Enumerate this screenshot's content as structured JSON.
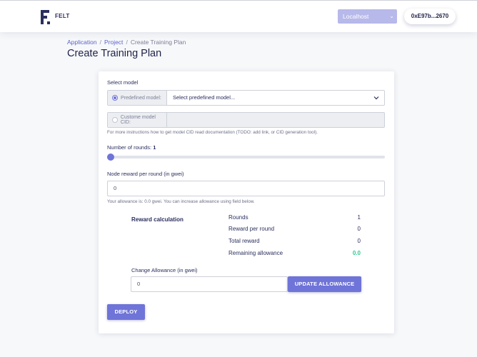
{
  "header": {
    "logo_text": "FELT",
    "network": "Localhost",
    "account": "0xE97b...2670"
  },
  "breadcrumb": [
    "Application",
    "Project",
    "Create Training Plan"
  ],
  "page_title": "Create Training Plan",
  "form": {
    "select_model_label": "Select model",
    "predefined_label": "Predefined model:",
    "predefined_placeholder": "Select predefined model...",
    "custom_label": "Custome model CID:",
    "custom_value": "",
    "model_help": "For more instructions how to get model CID read documentation (TODO: add link, or CID generation tool).",
    "rounds_label": "Number of rounds: ",
    "rounds_value": "1",
    "rounds_fraction": 0,
    "reward_label": "Node reward per round (in gwei)",
    "reward_value": "0",
    "allowance_help": "Your allowance is: 0.0 gwei. You can increase allowance using field below."
  },
  "reward_calc": {
    "title": "Reward calculation",
    "rows": [
      {
        "label": "Rounds",
        "value": "1"
      },
      {
        "label": "Reward per round",
        "value": "0"
      },
      {
        "label": "Total reward",
        "value": "0"
      },
      {
        "label": "Remaining allowance",
        "value": "0.0"
      }
    ]
  },
  "allowance": {
    "label": "Change Allowance (in gwei)",
    "value": "0",
    "button": "UPDATE ALLOWANCE"
  },
  "deploy_button": "DEPLOY",
  "colors": {
    "accent": "#6f74d8",
    "positive": "#2ec98e"
  }
}
